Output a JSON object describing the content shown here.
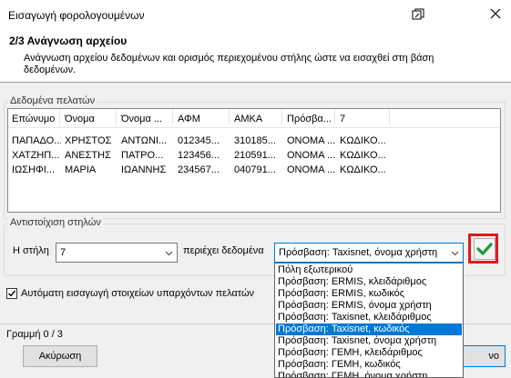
{
  "window": {
    "title": "Εισαγωγή φορολογουμένων"
  },
  "header": {
    "step_title": "2/3 Ανάγνωση αρχείου",
    "description": "Ανάγνωση αρχείου δεδομένων και ορισμός περιεχομένου στήλης ώστε να εισαχθεί στη βάση δεδομένων."
  },
  "customers_group": {
    "legend": "Δεδομένα πελατών",
    "columns": [
      "Επώνυμο",
      "Όνομα",
      "Όνομα ...",
      "ΑΦΜ",
      "ΑΜΚΑ",
      "Πρόσβα...",
      "7"
    ],
    "rows": [
      [
        "ΠΑΠΑΔΟ...",
        "ΧΡΗΣΤΟΣ",
        "ΑΝΤΩΝΙ...",
        "012345...",
        "310185...",
        "ΟΝΟΜΑ ...",
        "ΚΩΔΙΚΟ..."
      ],
      [
        "ΧΑΤΖΗΠ...",
        "ΑΝΕΣΤΗΣ",
        "ΠΑΤΡΟ...",
        "123456...",
        "210591...",
        "ΟΝΟΜΑ ...",
        "ΚΩΔΙΚΟ..."
      ],
      [
        "ΙΩΣΗΦΙ...",
        "ΜΑΡΙΑ",
        "ΙΩΑΝΝΗΣ",
        "234567...",
        "040791...",
        "ΟΝΟΜΑ ...",
        "ΚΩΔΙΚΟ..."
      ]
    ]
  },
  "mapping_group": {
    "legend": "Αντιστοίχιση στηλών",
    "column_label": "Η στήλη",
    "column_value": "7",
    "contains_label": "περιέχει δεδομένα",
    "data_value": "Πρόσβαση: Taxisnet, όνομα χρήστη",
    "dropdown_options": [
      "Πόλη εξωτερικού",
      "Πρόσβαση: ERMIS, κλειδάριθμος",
      "Πρόσβαση: ERMIS, κωδικός",
      "Πρόσβαση: ERMIS, όνομα χρήστη",
      "Πρόσβαση: Taxisnet, κλειδάριθμος",
      "Πρόσβαση: Taxisnet, κωδικός",
      "Πρόσβαση: Taxisnet, όνομα χρήστη",
      "Πρόσβαση: ΓΕΜΗ, κλειδάριθμος",
      "Πρόσβαση: ΓΕΜΗ, κωδικός",
      "Πρόσβαση: ΓΕΜΗ, όνομα χρήστη"
    ],
    "highlighted_option": "Πρόσβαση: Taxisnet, κωδικός"
  },
  "auto_import": {
    "label": "Αυτόματη εισαγωγή στοιχείων υπαρχόντων πελατών",
    "checked": true
  },
  "status": {
    "row_text": "Γραμμή 0 / 3"
  },
  "buttons": {
    "cancel": "Ακύρωση",
    "next_partial": "νο"
  },
  "colors": {
    "highlight_red": "#e21b1b",
    "ok_green": "#1e9a3a",
    "selection_blue": "#0078d7"
  }
}
